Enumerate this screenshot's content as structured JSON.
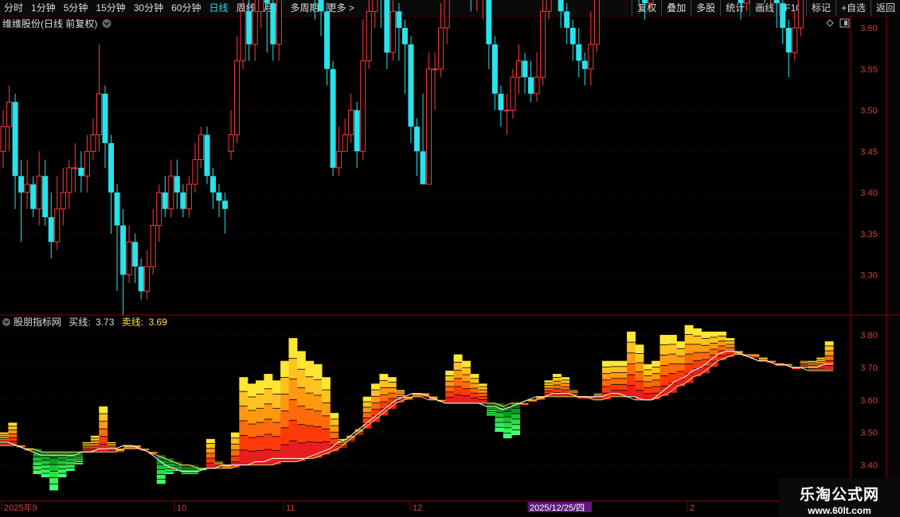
{
  "toolbar": {
    "periods": [
      "分时",
      "1分钟",
      "5分钟",
      "15分钟",
      "30分钟",
      "60分钟",
      "日线",
      "周线",
      "月线",
      "多周期",
      "更多 >"
    ],
    "active": "日线",
    "right_buttons": [
      "复权",
      "叠加",
      "多股",
      "统计",
      "画线",
      "F10",
      "标记",
      "+自选",
      "返回"
    ]
  },
  "main_panel": {
    "title": "维维股份(日线 前复权)",
    "price_labels": [
      "3.80",
      "3.75",
      "3.70",
      "3.65",
      "3.60",
      "3.55",
      "3.50",
      "3.45",
      "3.40",
      "3.35",
      "3.30"
    ]
  },
  "indicator_panel": {
    "name": "股朋指标网",
    "buy_label": "买线:",
    "buy_value": "3.73",
    "sell_label": "卖线:",
    "sell_value": "3.69",
    "price_labels": [
      "3.80",
      "3.70",
      "3.60",
      "3.50",
      "3.40"
    ]
  },
  "time_axis": {
    "labels": [
      "2025年9",
      "10",
      "11",
      "12",
      "2025/12/25/四",
      "2"
    ]
  },
  "watermark": {
    "line1": "乐淘公式网",
    "line2": "www.60lt.com"
  },
  "colors": {
    "up": "#ff3a3a",
    "down": "#27e3ea",
    "grid": "#5a0000",
    "axis": "#8a0000",
    "active_tab": "#23e0e8"
  },
  "chart_data": {
    "type": "candlestick",
    "title": "维维股份(日线 前复权)",
    "ylim": [
      3.24,
      3.86
    ],
    "candles": [
      [
        3.45,
        3.48,
        3.43,
        3.5
      ],
      [
        3.48,
        3.51,
        3.45,
        3.53
      ],
      [
        3.51,
        3.42,
        3.38,
        3.52
      ],
      [
        3.42,
        3.4,
        3.34,
        3.44
      ],
      [
        3.4,
        3.41,
        3.38,
        3.44
      ],
      [
        3.41,
        3.38,
        3.37,
        3.42
      ],
      [
        3.38,
        3.42,
        3.36,
        3.45
      ],
      [
        3.42,
        3.37,
        3.36,
        3.44
      ],
      [
        3.37,
        3.34,
        3.32,
        3.4
      ],
      [
        3.34,
        3.38,
        3.33,
        3.42
      ],
      [
        3.38,
        3.4,
        3.36,
        3.43
      ],
      [
        3.4,
        3.43,
        3.38,
        3.44
      ],
      [
        3.43,
        3.43,
        3.4,
        3.46
      ],
      [
        3.43,
        3.42,
        3.4,
        3.45
      ],
      [
        3.42,
        3.45,
        3.4,
        3.47
      ],
      [
        3.45,
        3.47,
        3.44,
        3.49
      ],
      [
        3.47,
        3.52,
        3.45,
        3.58
      ],
      [
        3.52,
        3.46,
        3.43,
        3.53
      ],
      [
        3.46,
        3.4,
        3.35,
        3.47
      ],
      [
        3.4,
        3.36,
        3.28,
        3.41
      ],
      [
        3.36,
        3.3,
        3.25,
        3.38
      ],
      [
        3.3,
        3.34,
        3.29,
        3.36
      ],
      [
        3.34,
        3.31,
        3.29,
        3.35
      ],
      [
        3.31,
        3.28,
        3.27,
        3.32
      ],
      [
        3.28,
        3.31,
        3.27,
        3.33
      ],
      [
        3.31,
        3.36,
        3.3,
        3.38
      ],
      [
        3.36,
        3.4,
        3.34,
        3.41
      ],
      [
        3.4,
        3.38,
        3.37,
        3.42
      ],
      [
        3.38,
        3.42,
        3.37,
        3.44
      ],
      [
        3.42,
        3.4,
        3.38,
        3.44
      ],
      [
        3.4,
        3.38,
        3.37,
        3.41
      ],
      [
        3.38,
        3.41,
        3.37,
        3.42
      ],
      [
        3.41,
        3.44,
        3.4,
        3.46
      ],
      [
        3.44,
        3.47,
        3.43,
        3.48
      ],
      [
        3.47,
        3.42,
        3.41,
        3.48
      ],
      [
        3.42,
        3.4,
        3.38,
        3.43
      ],
      [
        3.4,
        3.39,
        3.37,
        3.41
      ],
      [
        3.39,
        3.38,
        3.35,
        3.4
      ]
    ],
    "candles_2": [
      [
        3.45,
        3.47,
        3.44,
        3.5
      ],
      [
        3.47,
        3.56,
        3.46,
        3.59
      ],
      [
        3.56,
        3.62,
        3.55,
        3.67
      ],
      [
        3.62,
        3.58,
        3.56,
        3.65
      ],
      [
        3.58,
        3.62,
        3.56,
        3.66
      ],
      [
        3.62,
        3.67,
        3.6,
        3.69
      ],
      [
        3.67,
        3.63,
        3.57,
        3.68
      ],
      [
        3.63,
        3.58,
        3.56,
        3.66
      ],
      [
        3.58,
        3.7,
        3.56,
        3.72
      ],
      [
        3.7,
        3.77,
        3.68,
        3.79
      ],
      [
        3.77,
        3.73,
        3.7,
        3.79
      ],
      [
        3.73,
        3.71,
        3.69,
        3.75
      ],
      [
        3.71,
        3.68,
        3.66,
        3.73
      ],
      [
        3.68,
        3.7,
        3.66,
        3.72
      ],
      [
        3.7,
        3.65,
        3.61,
        3.71
      ],
      [
        3.65,
        3.62,
        3.59,
        3.67
      ],
      [
        3.62,
        3.55,
        3.53,
        3.63
      ],
      [
        3.55,
        3.43,
        3.42,
        3.56
      ],
      [
        3.43,
        3.45,
        3.42,
        3.48
      ],
      [
        3.45,
        3.47,
        3.45,
        3.49
      ],
      [
        3.47,
        3.5,
        3.46,
        3.52
      ],
      [
        3.5,
        3.45,
        3.43,
        3.51
      ],
      [
        3.45,
        3.56,
        3.44,
        3.61
      ],
      [
        3.56,
        3.62,
        3.55,
        3.65
      ],
      [
        3.62,
        3.67,
        3.6,
        3.68
      ],
      [
        3.67,
        3.66,
        3.6,
        3.68
      ],
      [
        3.66,
        3.57,
        3.55,
        3.67
      ],
      [
        3.57,
        3.62,
        3.56,
        3.66
      ],
      [
        3.62,
        3.6,
        3.56,
        3.63
      ],
      [
        3.6,
        3.58,
        3.52,
        3.61
      ],
      [
        3.58,
        3.48,
        3.46,
        3.59
      ],
      [
        3.48,
        3.45,
        3.42,
        3.49
      ],
      [
        3.45,
        3.41,
        3.41,
        3.52
      ],
      [
        3.41,
        3.55,
        3.41,
        3.57
      ],
      [
        3.55,
        3.55,
        3.5,
        3.57
      ],
      [
        3.55,
        3.6,
        3.54,
        3.63
      ],
      [
        3.6,
        3.66,
        3.58,
        3.69
      ],
      [
        3.66,
        3.72,
        3.65,
        3.74
      ],
      [
        3.72,
        3.69,
        3.67,
        3.74
      ],
      [
        3.69,
        3.66,
        3.64,
        3.72
      ],
      [
        3.66,
        3.64,
        3.62,
        3.68
      ],
      [
        3.64,
        3.64,
        3.62,
        3.65
      ],
      [
        3.64,
        3.64,
        3.61,
        3.66
      ],
      [
        3.64,
        3.58,
        3.55,
        3.65
      ],
      [
        3.58,
        3.52,
        3.5,
        3.59
      ],
      [
        3.52,
        3.5,
        3.48,
        3.53
      ],
      [
        3.5,
        3.5,
        3.47,
        3.52
      ],
      [
        3.5,
        3.54,
        3.49,
        3.55
      ],
      [
        3.54,
        3.56,
        3.52,
        3.58
      ],
      [
        3.56,
        3.54,
        3.52,
        3.57
      ],
      [
        3.54,
        3.52,
        3.51,
        3.56
      ],
      [
        3.52,
        3.54,
        3.51,
        3.57
      ],
      [
        3.54,
        3.62,
        3.53,
        3.66
      ],
      [
        3.62,
        3.67,
        3.61,
        3.68
      ],
      [
        3.67,
        3.66,
        3.64,
        3.68
      ],
      [
        3.66,
        3.62,
        3.6,
        3.67
      ],
      [
        3.62,
        3.6,
        3.58,
        3.63
      ],
      [
        3.6,
        3.58,
        3.56,
        3.61
      ],
      [
        3.58,
        3.56,
        3.54,
        3.6
      ],
      [
        3.56,
        3.55,
        3.53,
        3.57
      ],
      [
        3.55,
        3.58,
        3.53,
        3.62
      ],
      [
        3.58,
        3.65,
        3.57,
        3.68
      ],
      [
        3.65,
        3.7,
        3.64,
        3.72
      ],
      [
        3.7,
        3.71,
        3.69,
        3.72
      ],
      [
        3.71,
        3.7,
        3.67,
        3.72
      ],
      [
        3.7,
        3.79,
        3.7,
        3.81
      ],
      [
        3.79,
        3.75,
        3.73,
        3.81
      ],
      [
        3.75,
        3.71,
        3.7,
        3.77
      ],
      [
        3.71,
        3.68,
        3.63,
        3.73
      ],
      [
        3.68,
        3.63,
        3.61,
        3.71
      ],
      [
        3.63,
        3.7,
        3.62,
        3.72
      ],
      [
        3.7,
        3.78,
        3.69,
        3.8
      ],
      [
        3.78,
        3.79,
        3.74,
        3.84
      ],
      [
        3.79,
        3.73,
        3.7,
        3.8
      ],
      [
        3.73,
        3.72,
        3.71,
        3.78
      ],
      [
        3.72,
        3.77,
        3.71,
        3.83
      ],
      [
        3.77,
        3.79,
        3.76,
        3.86
      ],
      [
        3.79,
        3.79,
        3.77,
        3.82
      ],
      [
        3.79,
        3.8,
        3.76,
        3.81
      ],
      [
        3.8,
        3.78,
        3.76,
        3.82
      ],
      [
        3.78,
        3.8,
        3.77,
        3.81
      ],
      [
        3.8,
        3.78,
        3.75,
        3.81
      ],
      [
        3.78,
        3.76,
        3.74,
        3.79
      ],
      [
        3.76,
        3.72,
        3.7,
        3.78
      ],
      [
        3.72,
        3.67,
        3.64,
        3.73
      ],
      [
        3.67,
        3.63,
        3.61,
        3.69
      ],
      [
        3.63,
        3.68,
        3.62,
        3.74
      ],
      [
        3.68,
        3.72,
        3.67,
        3.77
      ],
      [
        3.72,
        3.68,
        3.66,
        3.73
      ],
      [
        3.68,
        3.65,
        3.63,
        3.7
      ],
      [
        3.65,
        3.66,
        3.63,
        3.69
      ],
      [
        3.66,
        3.63,
        3.6,
        3.67
      ],
      [
        3.63,
        3.6,
        3.58,
        3.64
      ],
      [
        3.6,
        3.57,
        3.54,
        3.61
      ],
      [
        3.57,
        3.6,
        3.56,
        3.62
      ],
      [
        3.6,
        3.66,
        3.59,
        3.72
      ],
      [
        3.66,
        3.68,
        3.65,
        3.72
      ],
      [
        3.68,
        3.7,
        3.67,
        3.73
      ],
      [
        3.7,
        3.68,
        3.65,
        3.73
      ],
      [
        3.68,
        3.75,
        3.67,
        3.78
      ],
      [
        3.75,
        3.71,
        3.7,
        3.76
      ]
    ],
    "indicator": {
      "name": "股朋指标网",
      "ylim": [
        3.36,
        3.83
      ],
      "buy_line": [
        3.47,
        3.47,
        3.46,
        3.45,
        3.44,
        3.43,
        3.43,
        3.43,
        3.43,
        3.43,
        3.44,
        3.44,
        3.45,
        3.45,
        3.45,
        3.46,
        3.46,
        3.45,
        3.44,
        3.42,
        3.4,
        3.39,
        3.38,
        3.38,
        3.38,
        3.39,
        3.39,
        3.4,
        3.4,
        3.4,
        3.4,
        3.41,
        3.41,
        3.42,
        3.42,
        3.42,
        3.42,
        3.42,
        3.43,
        3.44,
        3.45,
        3.47,
        3.48,
        3.5,
        3.52,
        3.54,
        3.56,
        3.58,
        3.6,
        3.61,
        3.62,
        3.62,
        3.61,
        3.6,
        3.59,
        3.59,
        3.59,
        3.59,
        3.59,
        3.58,
        3.58,
        3.57,
        3.58,
        3.59,
        3.6,
        3.61,
        3.61,
        3.62,
        3.62,
        3.62,
        3.61,
        3.61,
        3.61,
        3.61,
        3.62,
        3.62,
        3.61,
        3.61,
        3.6,
        3.6,
        3.62,
        3.64,
        3.66,
        3.67,
        3.69,
        3.7,
        3.72,
        3.74,
        3.75,
        3.75,
        3.74,
        3.73,
        3.72,
        3.72,
        3.71,
        3.71,
        3.7,
        3.7,
        3.7,
        3.7,
        3.71,
        3.71
      ],
      "sell_line": [
        3.46,
        3.46,
        3.46,
        3.45,
        3.45,
        3.44,
        3.44,
        3.44,
        3.44,
        3.44,
        3.44,
        3.44,
        3.44,
        3.44,
        3.44,
        3.45,
        3.45,
        3.45,
        3.44,
        3.43,
        3.42,
        3.41,
        3.4,
        3.4,
        3.39,
        3.39,
        3.39,
        3.39,
        3.39,
        3.4,
        3.4,
        3.4,
        3.4,
        3.4,
        3.41,
        3.41,
        3.41,
        3.42,
        3.42,
        3.43,
        3.44,
        3.45,
        3.47,
        3.49,
        3.51,
        3.53,
        3.55,
        3.57,
        3.59,
        3.6,
        3.61,
        3.61,
        3.6,
        3.6,
        3.59,
        3.59,
        3.59,
        3.59,
        3.59,
        3.59,
        3.59,
        3.58,
        3.59,
        3.59,
        3.6,
        3.6,
        3.61,
        3.61,
        3.61,
        3.61,
        3.61,
        3.61,
        3.6,
        3.6,
        3.61,
        3.61,
        3.61,
        3.6,
        3.6,
        3.6,
        3.61,
        3.62,
        3.64,
        3.65,
        3.67,
        3.68,
        3.7,
        3.72,
        3.73,
        3.74,
        3.74,
        3.73,
        3.72,
        3.72,
        3.71,
        3.71,
        3.7,
        3.7,
        3.69,
        3.69,
        3.69,
        3.69
      ]
    }
  }
}
